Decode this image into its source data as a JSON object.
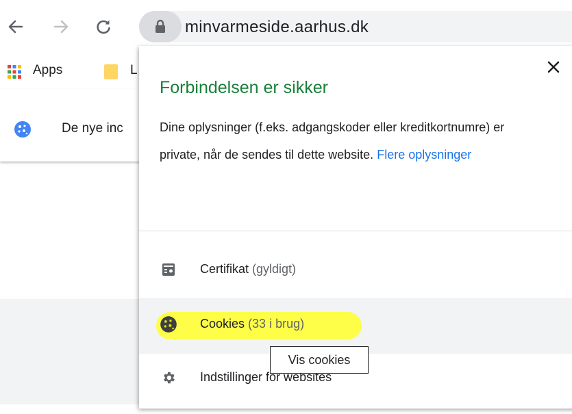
{
  "toolbar": {
    "back_icon": "arrow-left-icon",
    "forward_icon": "arrow-right-icon",
    "reload_icon": "reload-icon",
    "lock_icon": "lock-icon",
    "url": "minvarmeside.aarhus.dk"
  },
  "bookmarks": {
    "apps_label": "Apps",
    "folder_partial": "L"
  },
  "infobar": {
    "text": "De nye inc"
  },
  "popup": {
    "title": "Forbindelsen er sikker",
    "description": "Dine oplysninger (f.eks. adgangskoder eller kreditkortnumre) er private, når de sendes til dette website.",
    "link": "Flere oplysninger",
    "close_icon": "close-icon",
    "rows": [
      {
        "name": "Certifikat",
        "detail": "(gyldigt)",
        "icon": "certificate-icon"
      },
      {
        "name": "Cookies",
        "detail": "(33 i brug)",
        "icon": "cookie-icon"
      },
      {
        "name": "Indstillinger for websites",
        "detail": "",
        "icon": "gear-icon"
      }
    ],
    "tooltip": "Vis cookies"
  },
  "colors": {
    "secure_green": "#188038",
    "link_blue": "#1a73e8",
    "highlight": "#ffff3a"
  }
}
